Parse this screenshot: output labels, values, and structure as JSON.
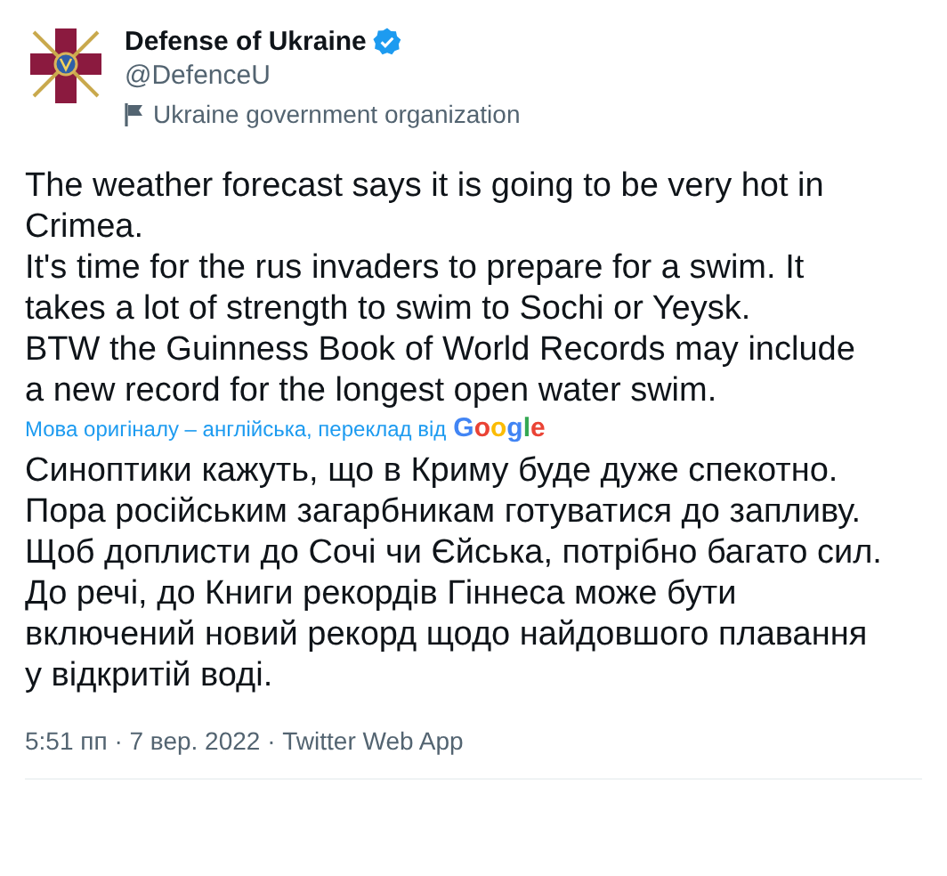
{
  "author": {
    "name": "Defense of Ukraine",
    "verified": true,
    "handle": "@DefenceU",
    "label": "Ukraine government organization"
  },
  "tweet": {
    "paragraphs": [
      "The weather forecast says it is going to be very hot in Crimea.",
      "It's time for the rus invaders to prepare for a swim. It takes a lot of strength to swim to Sochi or Yeysk.",
      "BTW the Guinness Book of World Records may include a new record for the longest open water swim."
    ]
  },
  "translation": {
    "note": "Мова оригіналу – англійська, переклад від",
    "provider": "Google",
    "paragraphs": [
      "Синоптики кажуть, що в Криму буде дуже спекотно.",
      "Пора російським загарбникам готуватися до запливу. Щоб доплисти до Сочі чи Єйська, потрібно багато сил.",
      "До речі, до Книги рекордів Гіннеса може бути включений новий рекорд щодо найдовшого плавання у відкритій воді."
    ]
  },
  "meta": {
    "line": "5:51 пп · 7 вер. 2022 · Twitter Web App"
  }
}
